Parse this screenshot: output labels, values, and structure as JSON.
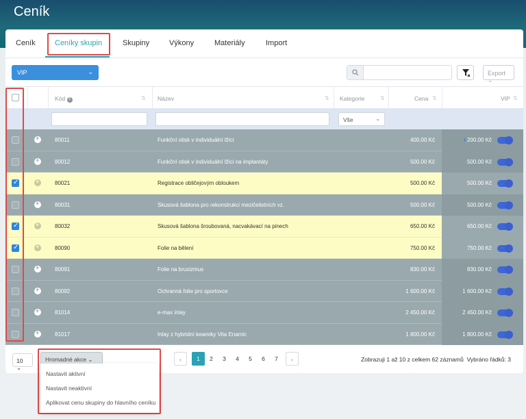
{
  "page": {
    "title": "Ceník"
  },
  "tabs": [
    {
      "label": "Ceník"
    },
    {
      "label": "Ceníky skupin"
    },
    {
      "label": "Skupiny"
    },
    {
      "label": "Výkony"
    },
    {
      "label": "Materiály"
    },
    {
      "label": "Import"
    }
  ],
  "toolbar": {
    "group_select": "VIP",
    "search_placeholder": "",
    "export_label": "Export"
  },
  "table": {
    "headers": {
      "code": "Kód",
      "name": "Název",
      "category": "Kategorie",
      "price": "Cena",
      "vip": "VIP"
    },
    "filters": {
      "category_value": "Vše"
    },
    "rows": [
      {
        "selected": false,
        "code": "80011",
        "name": "Funkční otisk v individuální lžíci",
        "price": "400.00 Kč",
        "vip_price": "200.00 Kč"
      },
      {
        "selected": false,
        "code": "80012",
        "name": "Funkční otisk v individuální lžíci na implantáty",
        "price": "500.00 Kč",
        "vip_price": "500.00 Kč"
      },
      {
        "selected": true,
        "code": "80021",
        "name": "Registrace obličejovým obloukem",
        "price": "500.00 Kč",
        "vip_price": "500.00 Kč"
      },
      {
        "selected": false,
        "code": "80031",
        "name": "Skusová šablona pro rekonstrukci mezičelistních vz.",
        "price": "500.00 Kč",
        "vip_price": "500.00 Kč"
      },
      {
        "selected": true,
        "code": "80032",
        "name": "Skusová šablona šroubovaná, nacvakávací na pinech",
        "price": "650.00 Kč",
        "vip_price": "650.00 Kč"
      },
      {
        "selected": true,
        "code": "80090",
        "name": "Folie na bělení",
        "price": "750.00 Kč",
        "vip_price": "750.00 Kč"
      },
      {
        "selected": false,
        "code": "80091",
        "name": "Folie na bruxizmus",
        "price": "830.00 Kč",
        "vip_price": "830.00 Kč"
      },
      {
        "selected": false,
        "code": "80092",
        "name": "Ochranná folie pro sportovce",
        "price": "1 600.00 Kč",
        "vip_price": "1 600.00 Kč"
      },
      {
        "selected": false,
        "code": "81014",
        "name": "e-max inlay",
        "price": "2 450.00 Kč",
        "vip_price": "2 450.00 Kč"
      },
      {
        "selected": false,
        "code": "81017",
        "name": "Inlay z hybridní keamiky Vita Enamic",
        "price": "1 800.00 Kč",
        "vip_price": "1 800.00 Kč"
      }
    ]
  },
  "footer": {
    "page_size": "10",
    "bulk_label": "Hromadné akce",
    "pages": [
      "1",
      "2",
      "3",
      "4",
      "5",
      "6",
      "7"
    ],
    "active_page": "1",
    "summary": "Zobrazuji 1 až 10 z celkem 62 záznamů",
    "selected": "Vybráno řádků: 3"
  },
  "bulk_menu": [
    "Nastavit aktivní",
    "Nastavit neaktivní",
    "Aplikovat cenu skupiny do hlavního ceníku"
  ],
  "colors": {
    "accent": "#2aa2b5",
    "primary": "#3b8fdc",
    "highlight": "#e04848",
    "selected_row": "#fdfcc4"
  },
  "icons": {
    "search": "search-icon",
    "filter": "filter-clear-icon",
    "info": "help-icon",
    "sort": "sort-icon"
  }
}
